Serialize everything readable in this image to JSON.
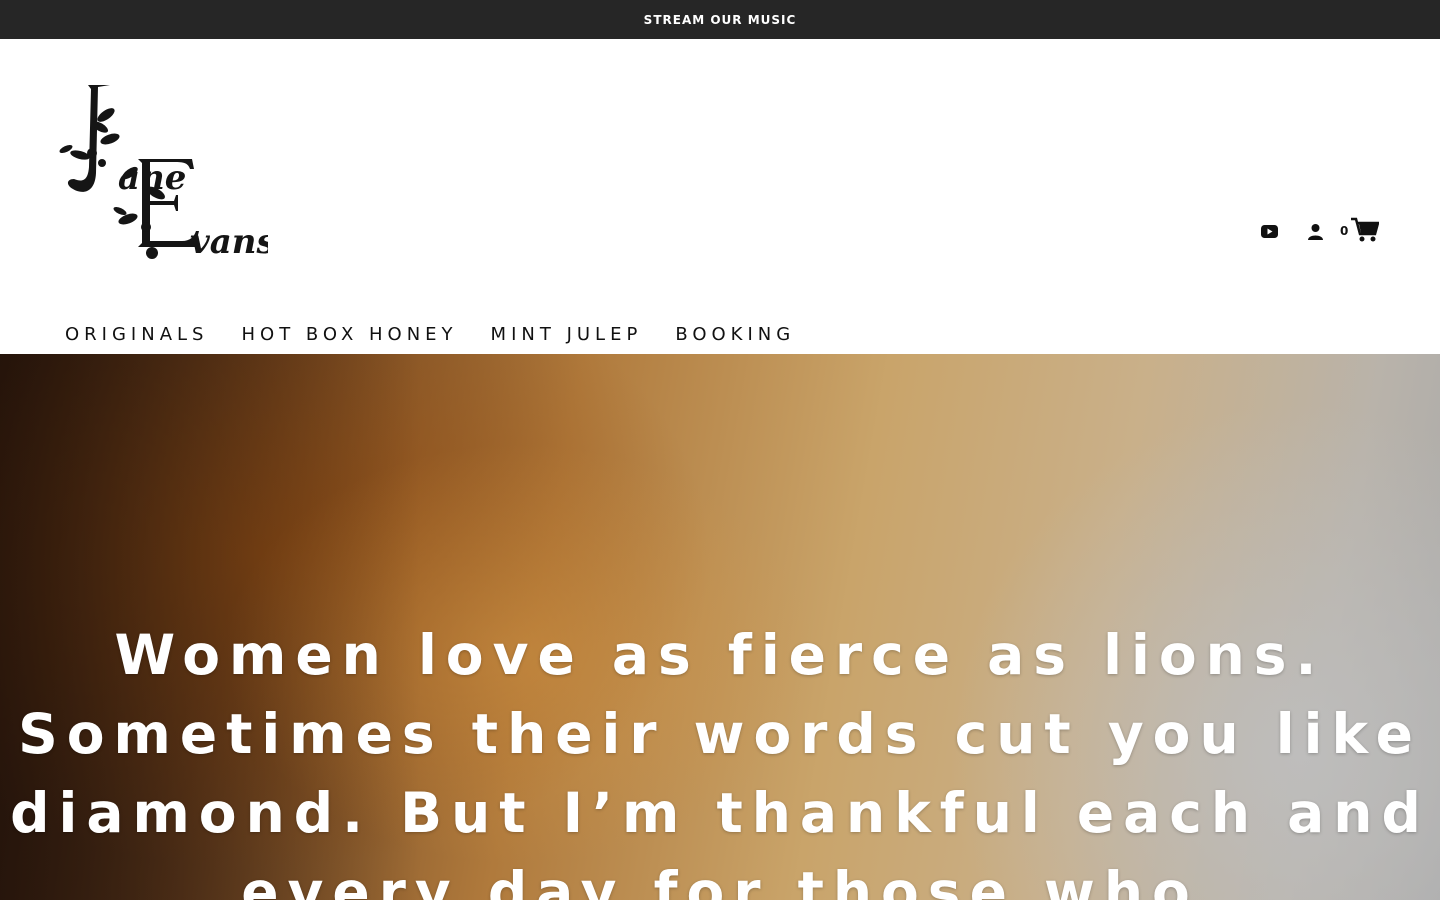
{
  "announcement": {
    "text": "STREAM OUR MUSIC"
  },
  "brand": {
    "logo_alt": "Jane Evans",
    "first": "ane",
    "last": "vans"
  },
  "header_icons": {
    "youtube": "youtube-icon",
    "account": "user-icon",
    "cart": "cart-icon",
    "cart_count": "0"
  },
  "nav": {
    "items": [
      {
        "label": "ORIGINALS"
      },
      {
        "label": "HOT BOX HONEY"
      },
      {
        "label": "MINT JULEP"
      },
      {
        "label": "BOOKING"
      }
    ]
  },
  "hero": {
    "quote": "Women love as fierce as lions. Sometimes their words cut you like diamond. But I’m thankful each and every day for those who"
  },
  "colors": {
    "announcement_bg": "#262626",
    "text_dark": "#111111",
    "hero_text": "#ffffff"
  }
}
